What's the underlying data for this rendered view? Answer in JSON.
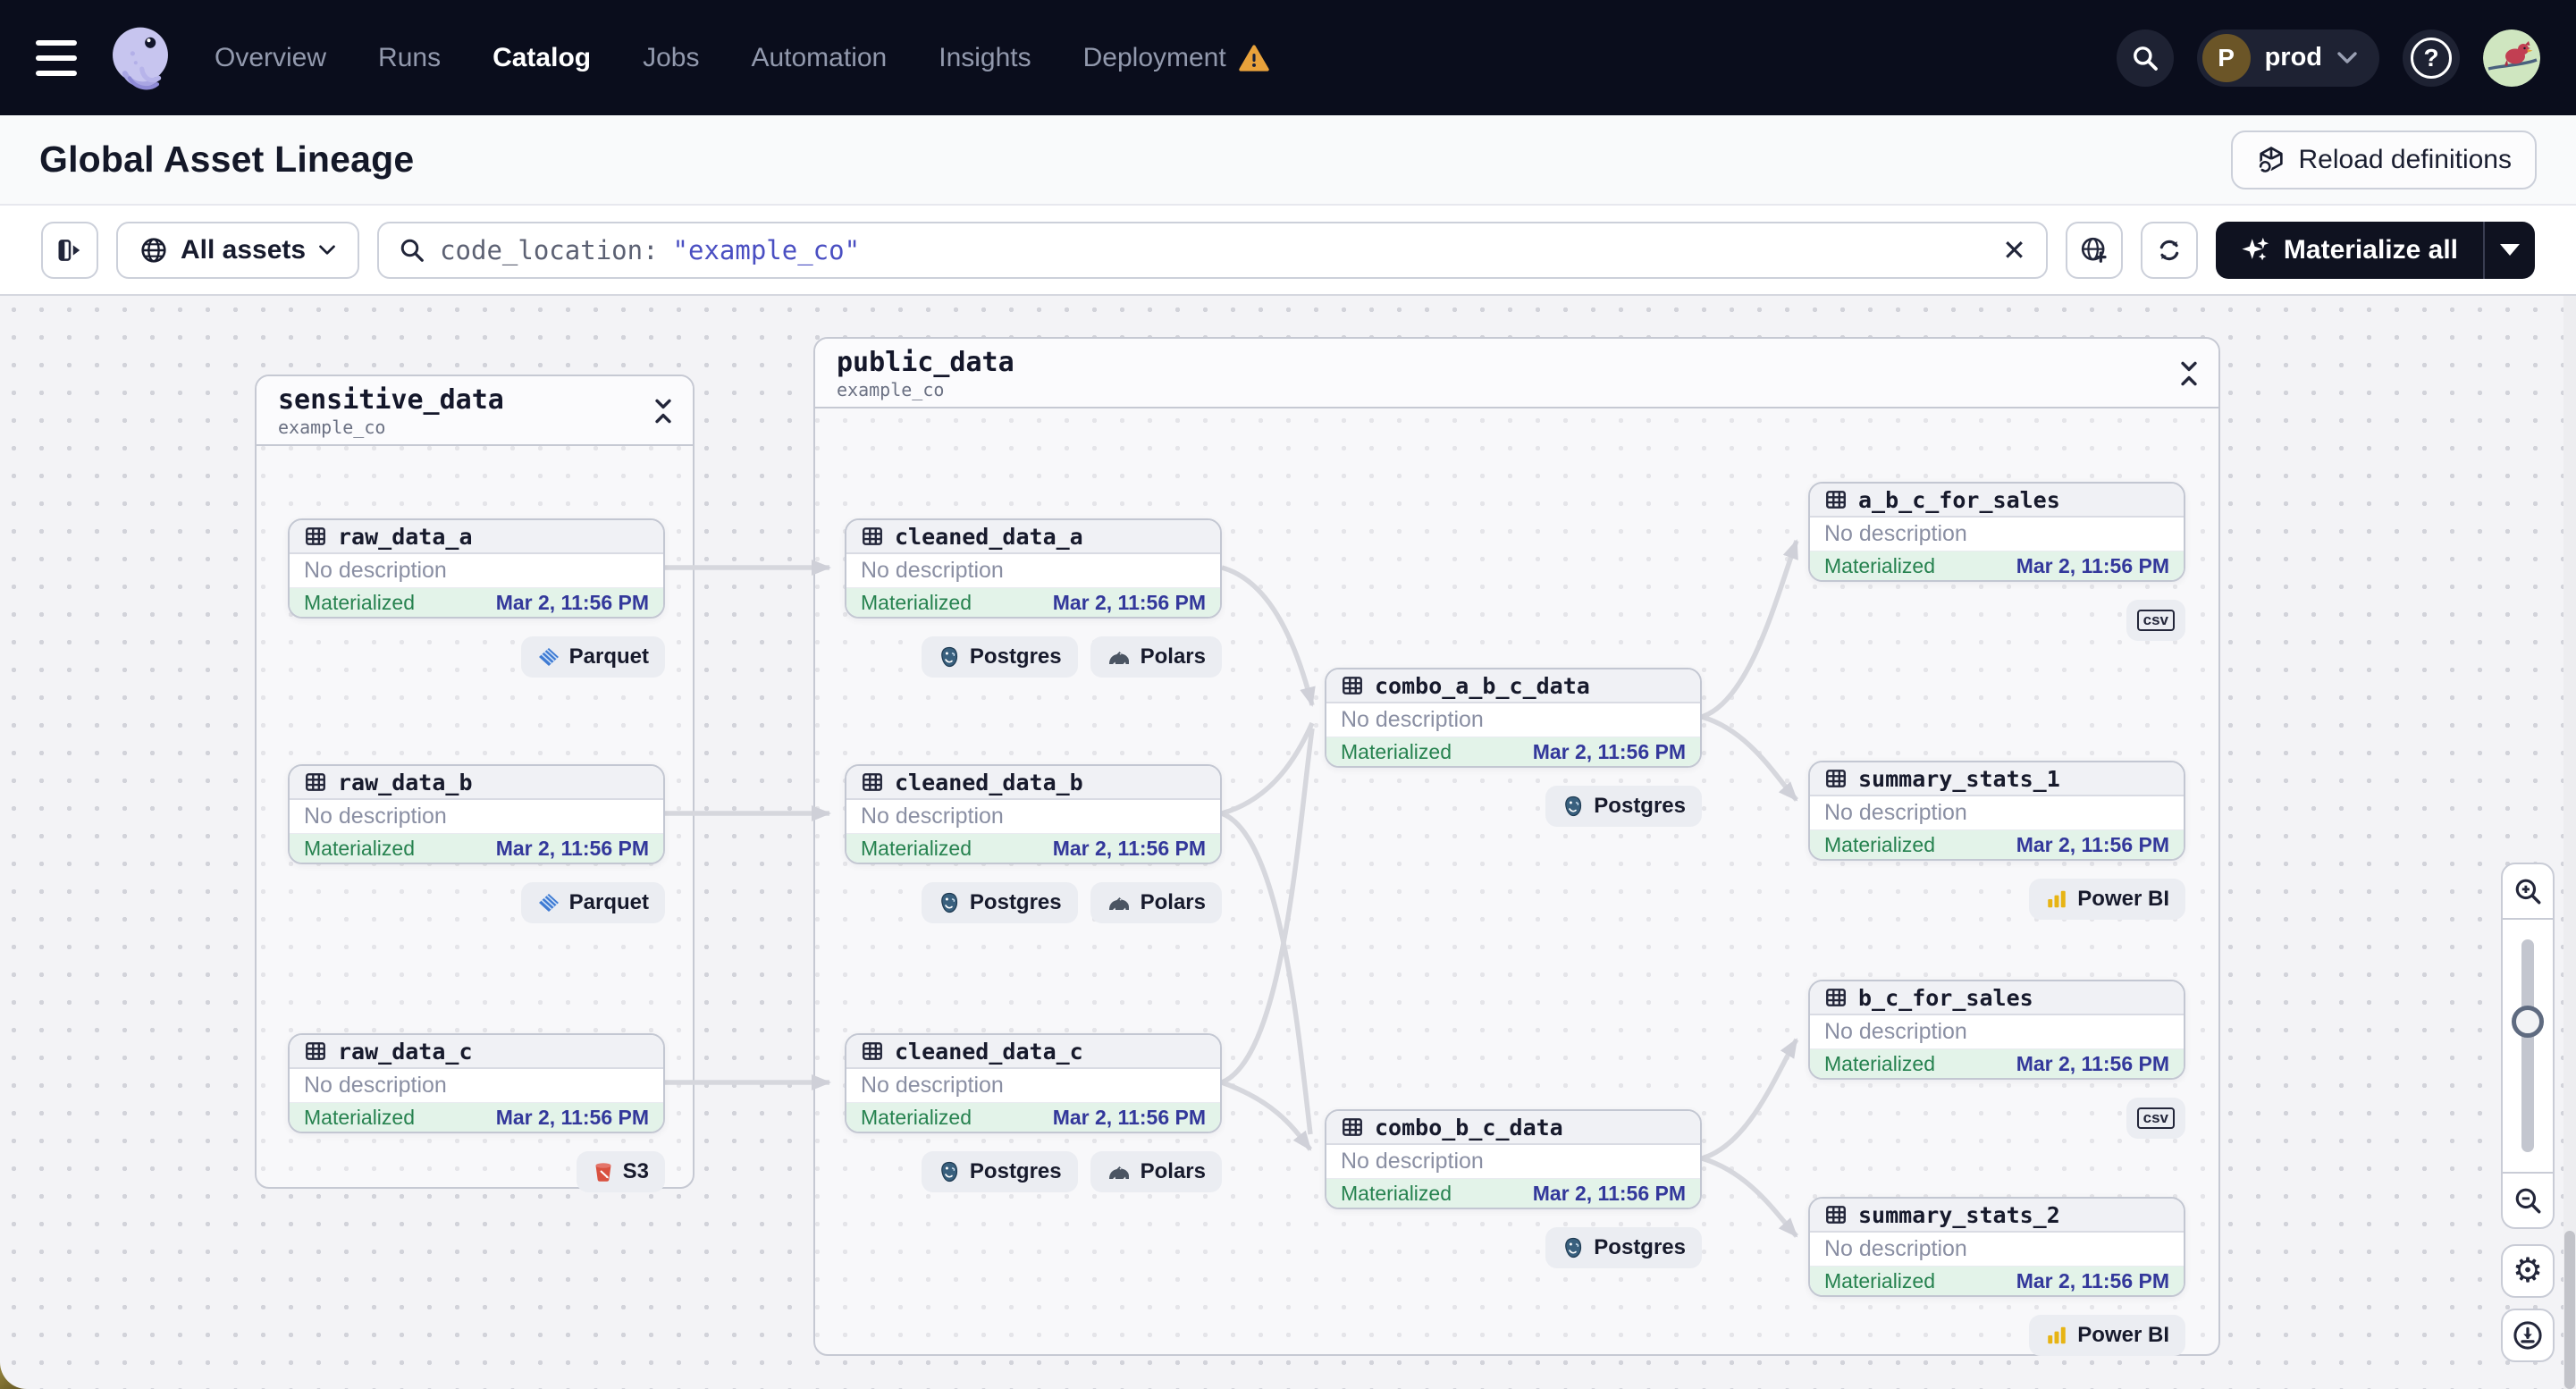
{
  "nav": {
    "items": [
      {
        "label": "Overview",
        "active": false
      },
      {
        "label": "Runs",
        "active": false
      },
      {
        "label": "Catalog",
        "active": true
      },
      {
        "label": "Jobs",
        "active": false
      },
      {
        "label": "Automation",
        "active": false
      },
      {
        "label": "Insights",
        "active": false
      },
      {
        "label": "Deployment",
        "active": false,
        "warning": true
      }
    ],
    "deployment": {
      "initial": "P",
      "label": "prod"
    }
  },
  "header": {
    "title": "Global Asset Lineage",
    "reload_label": "Reload definitions"
  },
  "filterbar": {
    "scope_label": "All assets",
    "search_field": "code_location:",
    "search_value": "\"example_co\"",
    "clear_label": "✕",
    "materialize_label": "Materialize all"
  },
  "graph": {
    "groups": [
      {
        "name": "sensitive_data",
        "location": "example_co"
      },
      {
        "name": "public_data",
        "location": "example_co"
      }
    ],
    "nodes": [
      {
        "label": "raw_data_a",
        "description": "No description",
        "status": "Materialized",
        "timestamp": "Mar 2, 11:56 PM",
        "badges": [
          {
            "kind": "parquet",
            "label": "Parquet"
          }
        ]
      },
      {
        "label": "raw_data_b",
        "description": "No description",
        "status": "Materialized",
        "timestamp": "Mar 2, 11:56 PM",
        "badges": [
          {
            "kind": "parquet",
            "label": "Parquet"
          }
        ]
      },
      {
        "label": "raw_data_c",
        "description": "No description",
        "status": "Materialized",
        "timestamp": "Mar 2, 11:56 PM",
        "badges": [
          {
            "kind": "s3",
            "label": "S3"
          }
        ]
      },
      {
        "label": "cleaned_data_a",
        "description": "No description",
        "status": "Materialized",
        "timestamp": "Mar 2, 11:56 PM",
        "badges": [
          {
            "kind": "postgres",
            "label": "Postgres"
          },
          {
            "kind": "polars",
            "label": "Polars"
          }
        ]
      },
      {
        "label": "cleaned_data_b",
        "description": "No description",
        "status": "Materialized",
        "timestamp": "Mar 2, 11:56 PM",
        "badges": [
          {
            "kind": "postgres",
            "label": "Postgres"
          },
          {
            "kind": "polars",
            "label": "Polars"
          }
        ]
      },
      {
        "label": "cleaned_data_c",
        "description": "No description",
        "status": "Materialized",
        "timestamp": "Mar 2, 11:56 PM",
        "badges": [
          {
            "kind": "postgres",
            "label": "Postgres"
          },
          {
            "kind": "polars",
            "label": "Polars"
          }
        ]
      },
      {
        "label": "combo_a_b_c_data",
        "description": "No description",
        "status": "Materialized",
        "timestamp": "Mar 2, 11:56 PM",
        "badges": [
          {
            "kind": "postgres",
            "label": "Postgres"
          }
        ]
      },
      {
        "label": "combo_b_c_data",
        "description": "No description",
        "status": "Materialized",
        "timestamp": "Mar 2, 11:56 PM",
        "badges": [
          {
            "kind": "postgres",
            "label": "Postgres"
          }
        ]
      },
      {
        "label": "a_b_c_for_sales",
        "description": "No description",
        "status": "Materialized",
        "timestamp": "Mar 2, 11:56 PM",
        "badges": [
          {
            "kind": "csv",
            "label": "csv"
          }
        ]
      },
      {
        "label": "summary_stats_1",
        "description": "No description",
        "status": "Materialized",
        "timestamp": "Mar 2, 11:56 PM",
        "badges": [
          {
            "kind": "powerbi",
            "label": "Power BI"
          }
        ]
      },
      {
        "label": "b_c_for_sales",
        "description": "No description",
        "status": "Materialized",
        "timestamp": "Mar 2, 11:56 PM",
        "badges": [
          {
            "kind": "csv",
            "label": "csv"
          }
        ]
      },
      {
        "label": "summary_stats_2",
        "description": "No description",
        "status": "Materialized",
        "timestamp": "Mar 2, 11:56 PM",
        "badges": [
          {
            "kind": "powerbi",
            "label": "Power BI"
          }
        ]
      }
    ]
  },
  "icons": {
    "menu": "hamburger-icon",
    "logo": "dagster-octopus-logo",
    "search": "magnifier-icon",
    "help": "question-circle-icon",
    "warning": "warning-triangle-icon",
    "reload": "cube-reload-icon",
    "panel_toggle": "open-panel-icon",
    "scope": "globe-icon",
    "clear": "close-x-icon",
    "new_tab": "globe-plus-icon",
    "refresh": "refresh-icon",
    "materialize": "sparkles-icon",
    "collapse": "collapse-vertical-icon",
    "asset": "table-grid-icon",
    "zoom_in": "zoom-in-icon",
    "zoom_out": "zoom-out-icon",
    "settings": "gear-icon",
    "download": "download-icon"
  },
  "colors": {
    "nav_bg": "#0a0d1c",
    "accent_green": "#26824f",
    "footer_green_bg": "#e3f3e9",
    "timestamp_indigo": "#33389b",
    "search_value_indigo": "#4a4fc2",
    "warning_orange": "#e9a23b",
    "edge_gray": "#d6d7dd",
    "canvas_bg": "#f3f3f6"
  }
}
